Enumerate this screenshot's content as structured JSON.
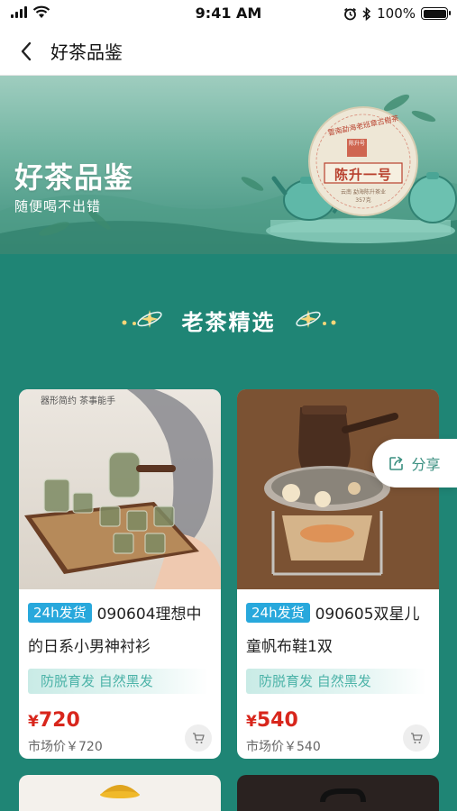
{
  "status_bar": {
    "time": "9:41 AM",
    "battery": "100%"
  },
  "nav": {
    "title": "好茶品鉴"
  },
  "banner": {
    "title": "好茶品鉴",
    "subtitle": "随便喝不出错",
    "cake_label": "陈升一号",
    "cake_rim_text": "雲南勐海老班章古樹茶",
    "cake_stamp": "陈升号",
    "cake_small": "云南 勐海陈升茶业",
    "cake_weight": "357克"
  },
  "section": {
    "title": "老茶精选"
  },
  "share": {
    "label": "分享",
    "icon": "share-icon"
  },
  "products": [
    {
      "image_caption": "器形简约 茶事能手",
      "image_icon": "glass-tea-set-image",
      "tag": "24h发货",
      "title": "090604理想中的日系小男神衬衫",
      "slogan": "防脱育发 自然黑发",
      "price_symbol": "¥",
      "price": "720",
      "market_price": "市场价￥720"
    },
    {
      "image_caption": "",
      "image_icon": "clay-pot-on-stove-image",
      "tag": "24h发货",
      "title": "090605双星儿童帆布鞋1双",
      "slogan": "防脱育发 自然黑发",
      "price_symbol": "¥",
      "price": "540",
      "market_price": "市场价￥540"
    }
  ],
  "colors": {
    "page_bg": "#1f8575",
    "tag_bg": "#28a8dc",
    "price": "#d8261c",
    "slogan_text": "#4cb3a8"
  }
}
